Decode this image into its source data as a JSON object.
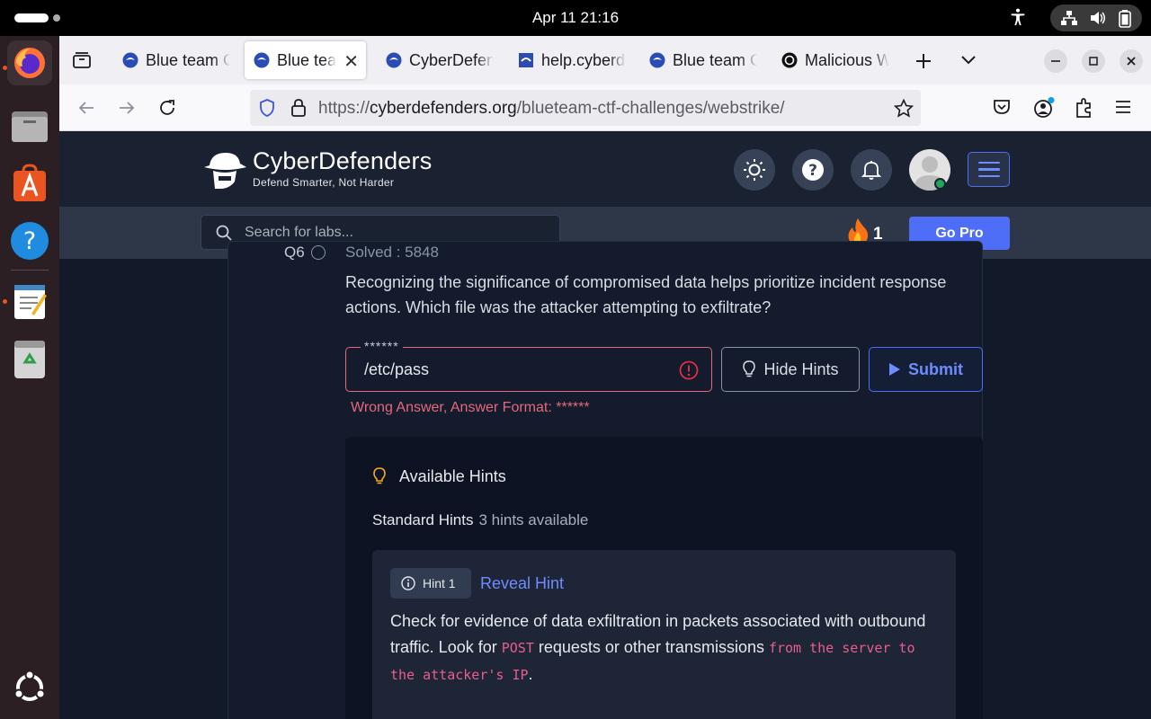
{
  "system": {
    "clock": "Apr 11  21:16"
  },
  "browser": {
    "tabs": [
      {
        "label": "Blue team CTF Challenges"
      },
      {
        "label": "Blue team CTF Challenges"
      },
      {
        "label": "CyberDefenders"
      },
      {
        "label": "help.cyberdefenders.org"
      },
      {
        "label": "Blue team CTF Challenges"
      },
      {
        "label": "Malicious Web"
      }
    ],
    "url_scheme": "https://",
    "url_host": "cyberdefenders.org",
    "url_path": "/blueteam-ctf-challenges/webstrike/"
  },
  "site": {
    "brand": "CyberDefenders",
    "tagline": "Defend Smarter, Not Harder",
    "search_placeholder": "Search for labs...",
    "streak": "1",
    "gopro_label": "Go Pro"
  },
  "question": {
    "number": "Q6",
    "solved": "Solved : 5848",
    "text": "Recognizing the significance of compromised data helps prioritize incident response actions. Which file was the attacker attempting to exfiltrate?",
    "answer_mask": "******",
    "answer_value": "/etc/pass",
    "hide_hints_label": "Hide Hints",
    "submit_label": "Submit",
    "error_text": "Wrong Answer, Answer Format: ******"
  },
  "hints": {
    "title": "Available Hints",
    "standard_label": "Standard Hints",
    "standard_count": "3 hints available",
    "hint1_badge": "Hint 1",
    "hint1_reveal": "Reveal Hint",
    "hint1_text_a": "Check for evidence of data exfiltration in packets associated with outbound traffic. Look for ",
    "hint1_code_a": "POST",
    "hint1_text_b": " requests or other transmissions ",
    "hint1_code_b": "from the server to the attacker's IP",
    "hint1_text_c": "."
  },
  "colors": {
    "accent": "#4f6ef7",
    "error": "#e46a7c",
    "page_bg": "#121a2a"
  }
}
